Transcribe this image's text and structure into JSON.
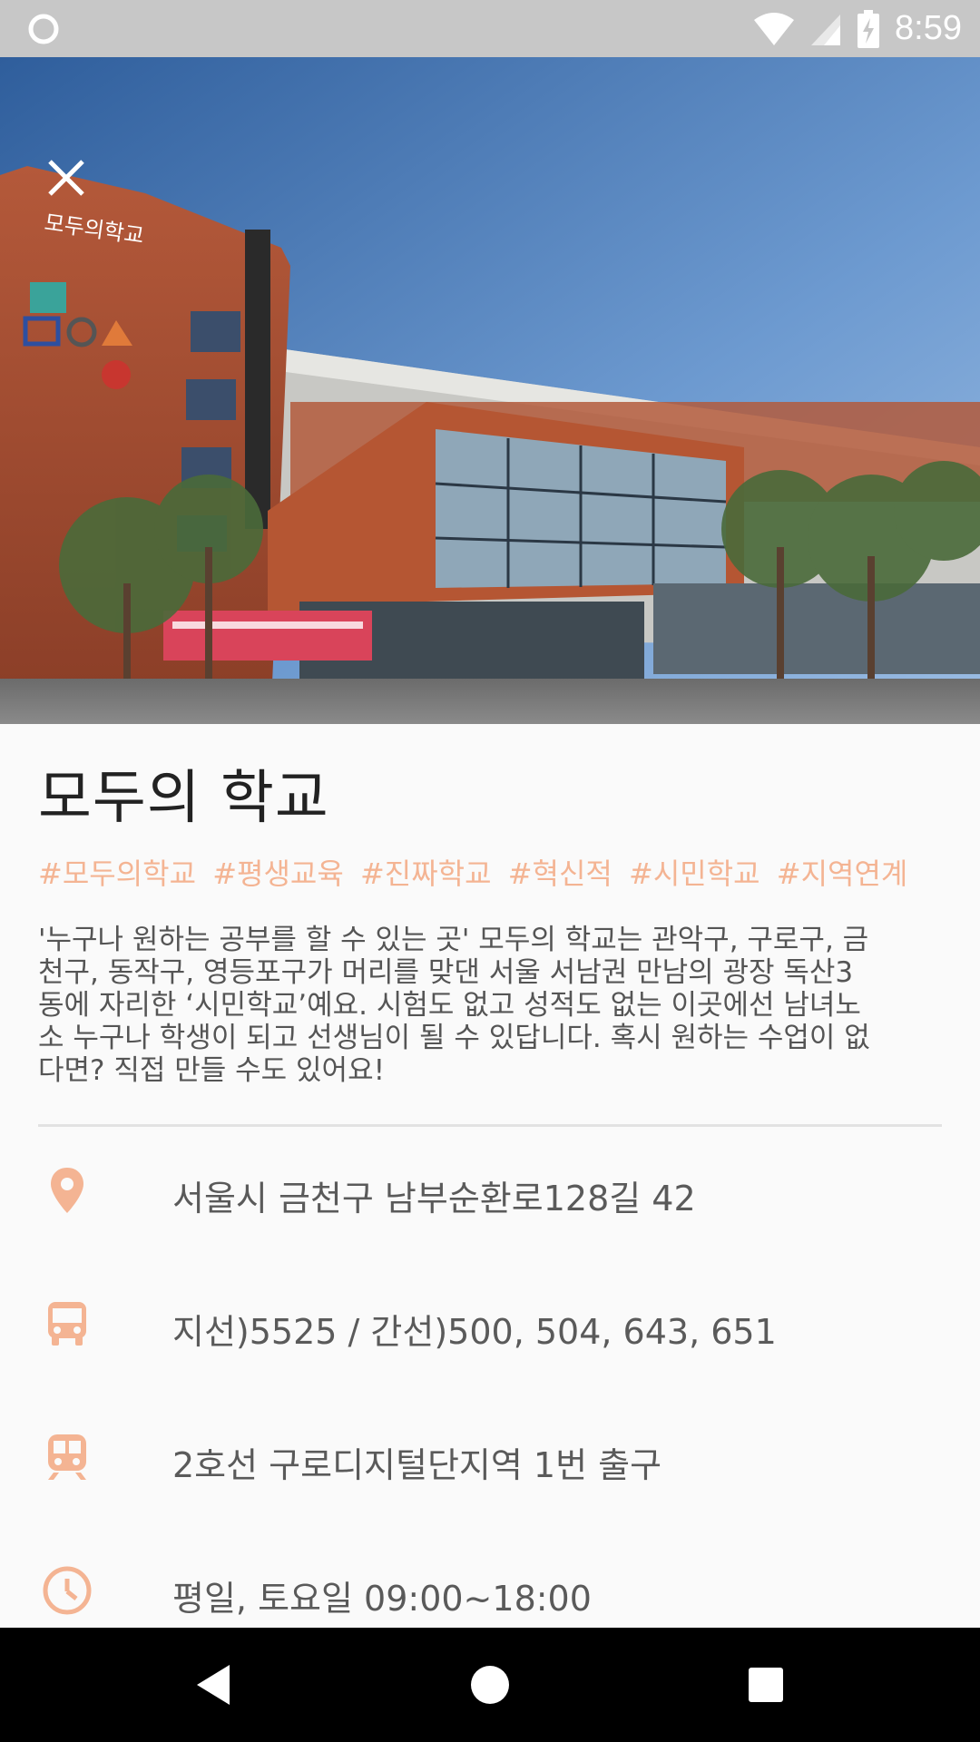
{
  "status_bar": {
    "time": "8:59",
    "icons": [
      "status-circle-icon",
      "wifi-icon",
      "signal-icon",
      "battery-charging-icon"
    ]
  },
  "hero": {
    "image_description": "school-building-photo",
    "close_icon": "close-icon"
  },
  "place": {
    "title": "모두의 학교",
    "tags": [
      "#모두의학교",
      "#평생교육",
      "#진짜학교",
      "#혁신적",
      "#시민학교",
      "#지역연계"
    ],
    "description_lines": [
      "'누구나 원하는 공부를 할 수 있는 곳' 모두의 학교는 관악구, 구로구, 금",
      "천구, 동작구, 영등포구가 머리를 맞댄 서울 서남권 만남의 광장 독산3",
      "동에 자리한 ‘시민학교’예요. 시험도 없고 성적도 없는 이곳에선 남녀노",
      "소 누구나 학생이 되고 선생님이 될 수 있답니다. 혹시 원하는 수업이 없",
      "다면? 직접 만들 수도 있어요!"
    ]
  },
  "info": [
    {
      "icon": "location-pin-icon",
      "text": "서울시 금천구 남부순환로128길 42"
    },
    {
      "icon": "bus-icon",
      "text": "지선)5525 / 간선)500, 504, 643, 651"
    },
    {
      "icon": "subway-icon",
      "text": "2호선 구로디지털단지역 1번 출구"
    },
    {
      "icon": "clock-icon",
      "text": "평일, 토요일 09:00~18:00"
    }
  ],
  "nav": {
    "back": "back-triangle-icon",
    "home": "home-circle-icon",
    "recents": "recents-square-icon"
  },
  "colors": {
    "accent": "#f4b493",
    "status_bar": "#c7c7c7",
    "nav_bar": "#000000",
    "text_primary": "#222222",
    "text_secondary": "#5a5a5a"
  }
}
